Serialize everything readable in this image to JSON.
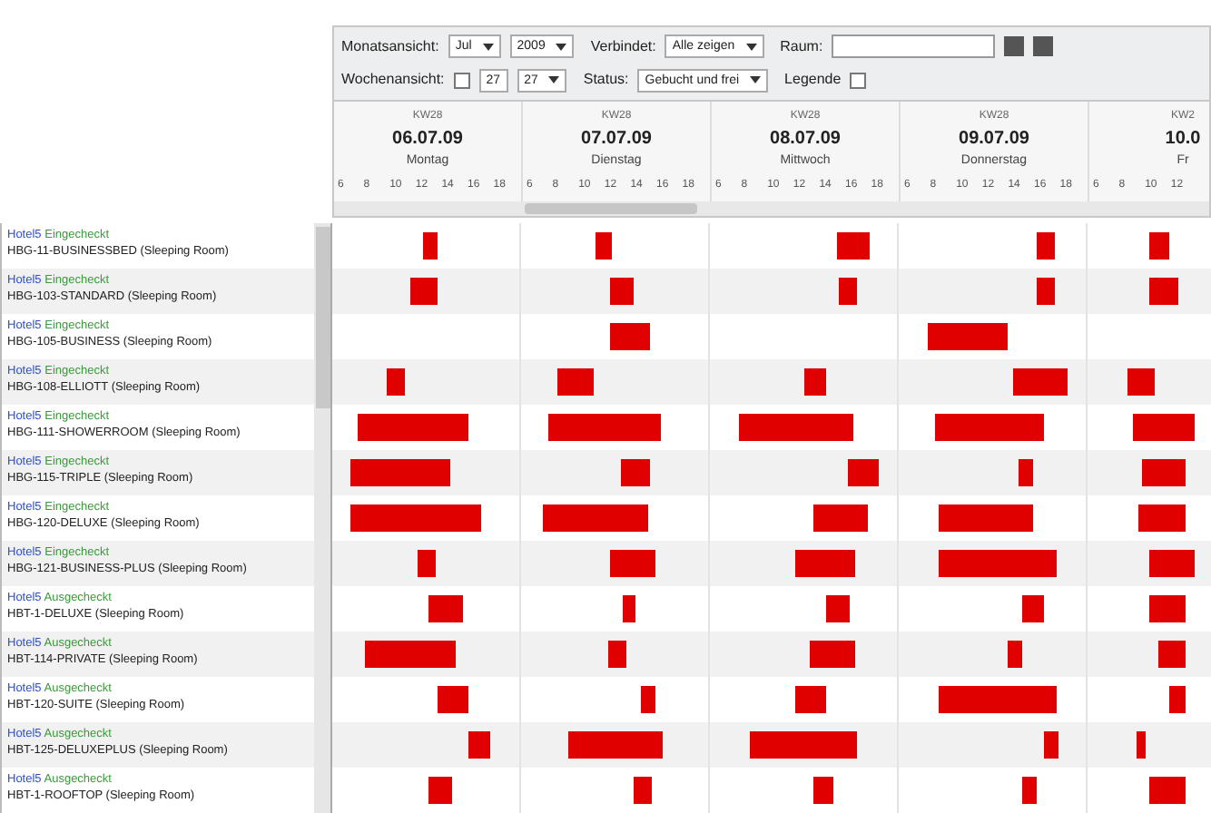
{
  "toolbar": {
    "rows": [
      {
        "label": "Monatsansicht:",
        "month": "Jul",
        "year": "2009",
        "filter_label": "Verbindet:",
        "filter_value": "Alle zeigen",
        "search_label": "Raum:",
        "search_value": ""
      },
      {
        "label": "Wochenansicht:",
        "week_checked": false,
        "week_from": "27",
        "week_to": "27",
        "filter_label": "Status:",
        "filter_value": "Gebucht und frei",
        "legend_label": "Legende",
        "legend_checked": false
      }
    ]
  },
  "days": [
    {
      "week": "KW28",
      "date": "06.07.09",
      "weekday": "Montag",
      "hours": [
        "6",
        "8",
        "10",
        "12",
        "14",
        "16",
        "18"
      ]
    },
    {
      "week": "KW28",
      "date": "07.07.09",
      "weekday": "Dienstag",
      "hours": [
        "6",
        "8",
        "10",
        "12",
        "14",
        "16",
        "18"
      ]
    },
    {
      "week": "KW28",
      "date": "08.07.09",
      "weekday": "Mittwoch",
      "hours": [
        "6",
        "8",
        "10",
        "12",
        "14",
        "16",
        "18"
      ]
    },
    {
      "week": "KW28",
      "date": "09.07.09",
      "weekday": "Donnerstag",
      "hours": [
        "6",
        "8",
        "10",
        "12",
        "14",
        "16",
        "18"
      ]
    },
    {
      "week": "KW2",
      "date": "10.0",
      "weekday": "Fr",
      "hours": [
        "6",
        "8",
        "10",
        "12"
      ]
    }
  ],
  "rooms": [
    {
      "hotel": "Hotel5",
      "status": "Eingecheckt",
      "name": "HBG-11-BUSINESSBED (Sleeping Room)"
    },
    {
      "hotel": "Hotel5",
      "status": "Eingecheckt",
      "name": "HBG-103-STANDARD (Sleeping Room)"
    },
    {
      "hotel": "Hotel5",
      "status": "Eingecheckt",
      "name": "HBG-105-BUSINESS (Sleeping Room)"
    },
    {
      "hotel": "Hotel5",
      "status": "Eingecheckt",
      "name": "HBG-108-ELLIOTT (Sleeping Room)"
    },
    {
      "hotel": "Hotel5",
      "status": "Eingecheckt",
      "name": "HBG-111-SHOWERROOM (Sleeping Room)"
    },
    {
      "hotel": "Hotel5",
      "status": "Eingecheckt",
      "name": "HBG-115-TRIPLE (Sleeping Room)"
    },
    {
      "hotel": "Hotel5",
      "status": "Eingecheckt",
      "name": "HBG-120-DELUXE (Sleeping Room)"
    },
    {
      "hotel": "Hotel5",
      "status": "Eingecheckt",
      "name": "HBG-121-BUSINESS-PLUS (Sleeping Room)"
    },
    {
      "hotel": "Hotel5",
      "status": "Ausgecheckt",
      "name": "HBT-1-DELUXE (Sleeping Room)"
    },
    {
      "hotel": "Hotel5",
      "status": "Ausgecheckt",
      "name": "HBT-114-PRIVATE (Sleeping Room)"
    },
    {
      "hotel": "Hotel5",
      "status": "Ausgecheckt",
      "name": "HBT-120-SUITE (Sleeping Room)"
    },
    {
      "hotel": "Hotel5",
      "status": "Ausgecheckt",
      "name": "HBT-125-DELUXEPLUS (Sleeping Room)"
    },
    {
      "hotel": "Hotel5",
      "status": "Ausgecheckt",
      "name": "HBT-1-ROOFTOP (Sleeping Room)"
    }
  ]
}
